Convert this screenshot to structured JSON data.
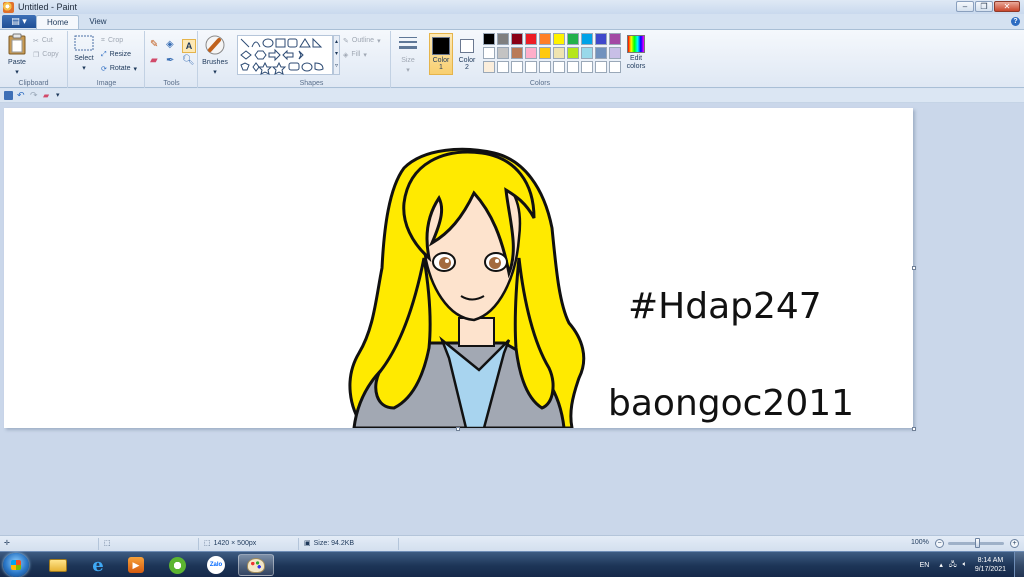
{
  "window": {
    "title": "Untitled - Paint"
  },
  "tabs": [
    {
      "label": "Home",
      "active": true
    },
    {
      "label": "View",
      "active": false
    }
  ],
  "ribbon": {
    "clipboard": {
      "label": "Clipboard",
      "paste": "Paste",
      "cut": "Cut",
      "copy": "Copy"
    },
    "image": {
      "label": "Image",
      "select": "Select",
      "crop": "Crop",
      "resize": "Resize",
      "rotate": "Rotate"
    },
    "tools": {
      "label": "Tools"
    },
    "brushes": {
      "label": "Brushes"
    },
    "shapes": {
      "label": "Shapes",
      "outline": "Outline",
      "fill": "Fill"
    },
    "size": {
      "label": "Size"
    },
    "colors": {
      "label": "Colors",
      "color1_label": "Color 1",
      "color1_value": "#000000",
      "color2_label": "Color 2",
      "color2_value": "#ffffff",
      "edit_colors": "Edit colors",
      "palette": [
        "#000000",
        "#7f7f7f",
        "#880015",
        "#ed1c24",
        "#ff7f27",
        "#fff200",
        "#22b14c",
        "#00a2e8",
        "#3f48cc",
        "#a349a4",
        "#ffffff",
        "#c3c3c3",
        "#b97a57",
        "#ffaec9",
        "#ffc90e",
        "#efe4b0",
        "#b5e61d",
        "#99d9ea",
        "#7092be",
        "#c8bfe7",
        "#fbeedc",
        "#ffffff",
        "#ffffff",
        "#ffffff",
        "#ffffff",
        "#ffffff",
        "#ffffff",
        "#ffffff",
        "#ffffff",
        "#ffffff"
      ]
    }
  },
  "canvas": {
    "texts": {
      "hashtag": "#Hdap247",
      "username": "baongoc2011"
    }
  },
  "statusbar": {
    "dimensions": "1420 × 500px",
    "size": "Size: 94.2KB",
    "zoom": "100%"
  },
  "taskbar": {
    "language": "EN",
    "time": "8:14 AM",
    "date": "9/17/2021",
    "zalo_label": "Zalo"
  }
}
